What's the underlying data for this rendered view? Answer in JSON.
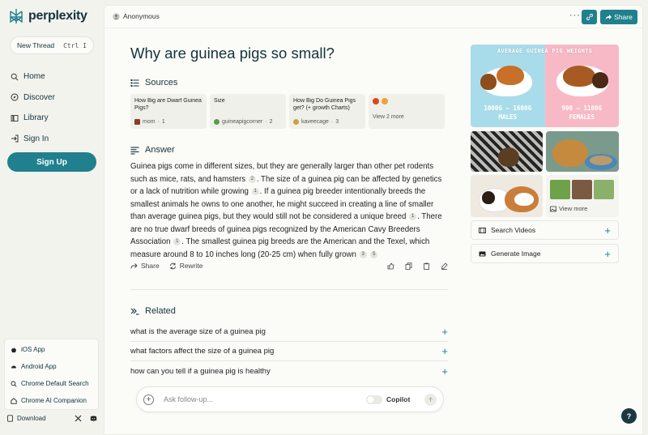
{
  "app": {
    "name": "perplexity",
    "brand_color": "#20808d"
  },
  "sidebar": {
    "new_thread": {
      "label": "New Thread",
      "shortcut": "Ctrl I"
    },
    "items": [
      {
        "label": "Home",
        "icon": "search-icon"
      },
      {
        "label": "Discover",
        "icon": "compass-icon"
      },
      {
        "label": "Library",
        "icon": "library-icon"
      },
      {
        "label": "Sign In",
        "icon": "sign-in-icon"
      }
    ],
    "signup_label": "Sign Up",
    "apps": [
      {
        "label": "iOS App",
        "icon": "apple-icon"
      },
      {
        "label": "Android App",
        "icon": "android-icon"
      },
      {
        "label": "Chrome Default Search",
        "icon": "search-icon"
      },
      {
        "label": "Chrome AI Companion",
        "icon": "chrome-icon"
      }
    ],
    "download_label": "Download"
  },
  "topbar": {
    "user": "Anonymous",
    "more": "···",
    "share_label": "Share"
  },
  "question": "Why are guinea pigs so small?",
  "sources": {
    "heading": "Sources",
    "items": [
      {
        "title": "How Big are Dwarf Guinea Pigs?",
        "site": "mom",
        "num": "1",
        "color": "#8a3b2a"
      },
      {
        "title": "Size",
        "site": "guineapigcorner",
        "num": "2",
        "color": "#5a9a4a"
      },
      {
        "title": "How Big Do Guinea Pigs get? (+ growth Charts)",
        "site": "kaveecage",
        "num": "3",
        "color": "#c9a43a"
      }
    ],
    "view_more": "View 2 more"
  },
  "answer": {
    "heading": "Answer",
    "segments": [
      {
        "text": "Guinea pigs come in different sizes, but they are generally larger than other pet rodents such as mice, rats, and hamsters",
        "cite": "2"
      },
      {
        "text": ". The size of a guinea pig can be affected by genetics or a lack of nutrition while growing",
        "cite": "1"
      },
      {
        "text": ". If a guinea pig breeder intentionally breeds the smallest animals he owns to one another, he might succeed in creating a line of smaller than average guinea pigs, but they would still not be considered a unique breed",
        "cite": "1"
      },
      {
        "text": ". There are no true dwarf breeds of guinea pigs recognized by the American Cavy Breeders Association",
        "cite": "1"
      },
      {
        "text": ". The smallest guinea pig breeds are the American and the Texel, which measure around 8 to 10 inches long (20-25 cm) when fully grown",
        "cite": "3"
      },
      {
        "text": "",
        "cite": "5"
      }
    ],
    "share_label": "Share",
    "rewrite_label": "Rewrite"
  },
  "related": {
    "heading": "Related",
    "items": [
      "what is the average size of a guinea pig",
      "what factors affect the size of a guinea pig",
      "how can you tell if a guinea pig is healthy"
    ]
  },
  "followup": {
    "placeholder": "Ask follow-up...",
    "copilot_label": "Copilot"
  },
  "media": {
    "hero_title": "AVERAGE GUINEA PIG WEIGHTS",
    "hero_left": "1000G – 1600G\nMALES",
    "hero_right": "900 – 1100G\nFEMALES",
    "view_more": "View more",
    "search_videos": "Search Videos",
    "generate_image": "Generate Image"
  },
  "help": "?"
}
